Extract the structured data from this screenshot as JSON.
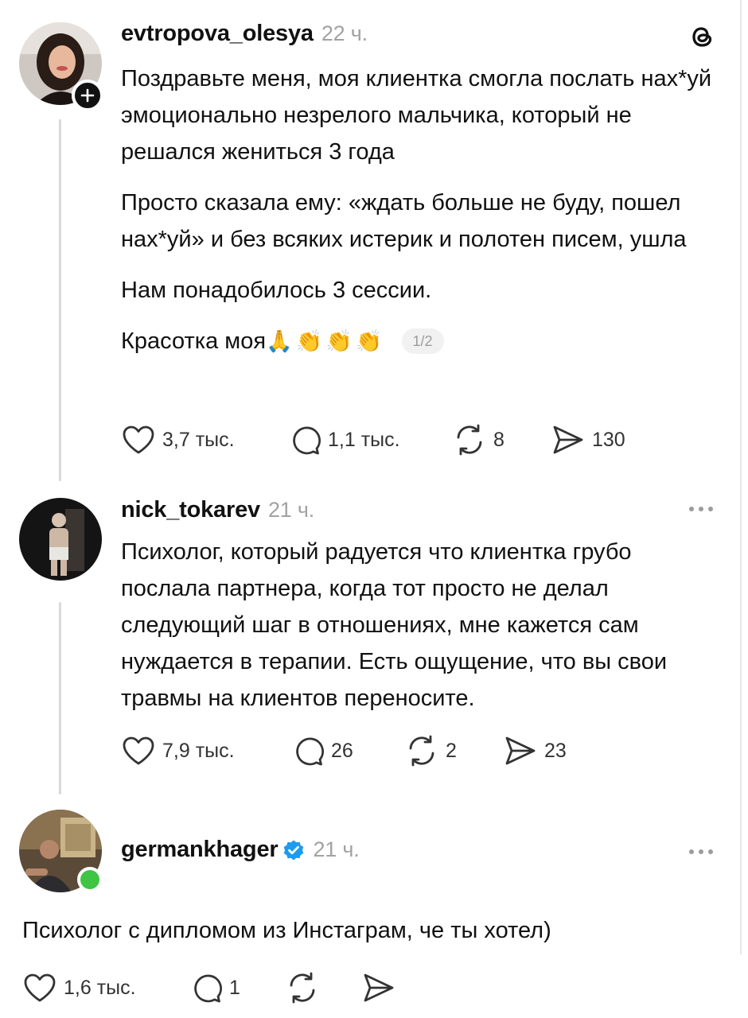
{
  "app": {
    "logo_icon": "threads-logo-icon"
  },
  "posts": [
    {
      "username": "evtropova_olesya",
      "time": "22 ч.",
      "paragraphs": [
        "Поздравьте меня, моя клиентка смогла послать нах*уй эмоционально незрелого мальчика, который не решался жениться 3 года",
        "Просто сказала ему: «ждать больше не буду, пошел нах*уй» и без всяких истерик и полотен писем, ушла",
        "Нам понадобилось 3 сессии."
      ],
      "last_line": "Красотка моя",
      "emojis": "🙏👏👏👏",
      "pager": "1/2",
      "likes": "3,7 тыс.",
      "comments": "1,1 тыс.",
      "reposts": "8",
      "shares": "130"
    },
    {
      "username": "nick_tokarev",
      "time": "21 ч.",
      "text": "Психолог, который радуется что клиентка грубо послала партнера, когда тот просто не делал следующий шаг в отношениях, мне кажется сам нуждается в терапии. Есть ощущение, что вы свои травмы на клиентов переносите.",
      "likes": "7,9 тыс.",
      "comments": "26",
      "reposts": "2",
      "shares": "23"
    },
    {
      "username": "germankhager",
      "time": "21 ч.",
      "text": "Психолог с дипломом из Инстаграм, че ты хотел)",
      "likes": "1,6 тыс.",
      "comments": "1"
    }
  ]
}
